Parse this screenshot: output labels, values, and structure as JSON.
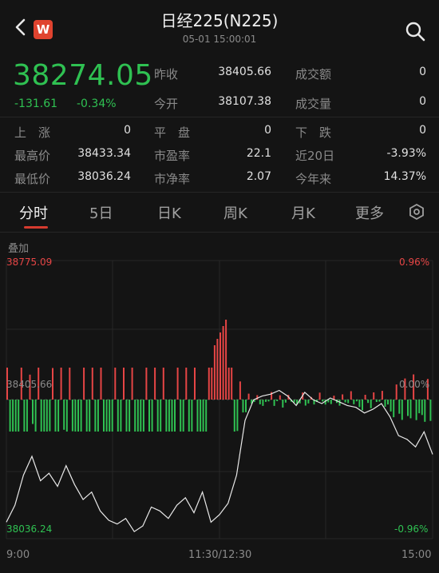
{
  "header": {
    "title": "日经225(N225)",
    "subtitle": "05-01 15:00:01",
    "logo_text": "W",
    "back_icon": "chevron-left-icon",
    "search_icon": "search-icon"
  },
  "quote": {
    "price": "38274.05",
    "change": "-131.61",
    "change_pct": "-0.34%",
    "prev_close_label": "昨收",
    "prev_close": "38405.66",
    "open_label": "今开",
    "open": "38107.38",
    "turnover_label": "成交额",
    "turnover": "0",
    "volume_label": "成交量",
    "volume": "0"
  },
  "stats": {
    "up_label": "上　涨",
    "up": "0",
    "flat_label": "平　盘",
    "flat": "0",
    "down_label": "下　跌",
    "down": "0",
    "high_label": "最高价",
    "high": "38433.34",
    "pe_label": "市盈率",
    "pe": "22.1",
    "d20_label": "近20日",
    "d20": "-3.93%",
    "low_label": "最低价",
    "low": "38036.24",
    "pb_label": "市净率",
    "pb": "2.07",
    "ytd_label": "今年来",
    "ytd": "14.37%"
  },
  "tabs": [
    "分时",
    "5日",
    "日K",
    "周K",
    "月K",
    "更多"
  ],
  "settings_icon": "settings-icon",
  "chart": {
    "overlay_label": "叠加",
    "top_value": "38775.09",
    "top_pct": "0.96%",
    "mid_value": "38405.66",
    "mid_pct": "0.00%",
    "bottom_value": "38036.24",
    "bottom_pct": "-0.96%",
    "x_start": "9:00",
    "x_mid": "11:30/12:30",
    "x_end": "15:00",
    "colors": {
      "up": "#e64545",
      "down": "#2fc152",
      "line": "#e8e8e8"
    }
  },
  "chart_data": {
    "type": "line",
    "x": [
      "9:00",
      "11:30/12:30",
      "15:00"
    ],
    "ylim": [
      38036.24,
      38775.09
    ],
    "reference": 38405.66,
    "series": [
      {
        "values": [
          38080,
          38125,
          38205,
          38255,
          38190,
          38210,
          38175,
          38230,
          38180,
          38140,
          38160,
          38110,
          38085,
          38075,
          38090,
          38055,
          38070,
          38120,
          38110,
          38090,
          38125,
          38145,
          38105,
          38160,
          38080,
          38100,
          38130,
          38205,
          38350,
          38405,
          38415,
          38420,
          38430,
          38415,
          38390,
          38425,
          38405,
          38395,
          38410,
          38400,
          38390,
          38385,
          38370,
          38380,
          38395,
          38360,
          38310,
          38300,
          38280,
          38320,
          38260
        ]
      }
    ]
  }
}
